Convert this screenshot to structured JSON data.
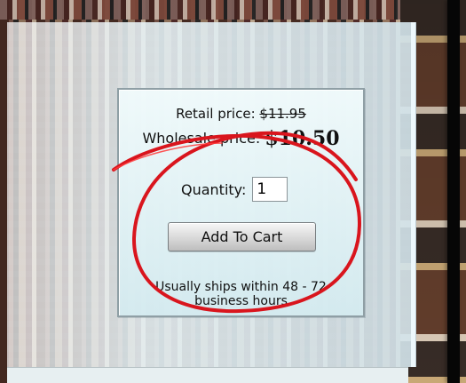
{
  "pricing": {
    "retail_label": "Retail price:",
    "retail_value": "$11.95",
    "wholesale_label": "Wholesale price:",
    "wholesale_value": "$10.50"
  },
  "cart": {
    "quantity_label": "Quantity:",
    "quantity_value": "1",
    "add_button_label": "Add To Cart"
  },
  "shipping": {
    "text": "Usually ships within 48 - 72 business hours"
  },
  "colors": {
    "annotation_red": "#d9151d",
    "panel_blue": "#dcecef",
    "border_gray": "#8f9fa5"
  }
}
